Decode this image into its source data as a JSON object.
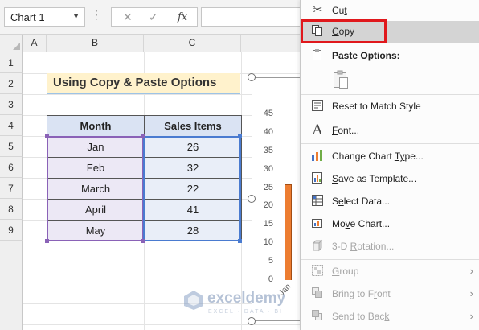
{
  "formula_bar": {
    "name_box": "Chart 1",
    "cancel_icon": "✕",
    "enter_icon": "✓",
    "fx_label": "fx"
  },
  "columns": [
    "A",
    "B",
    "C"
  ],
  "rows": [
    "1",
    "2",
    "3",
    "4",
    "5",
    "6",
    "7",
    "8",
    "9"
  ],
  "sheet": {
    "title": "Using Copy & Paste Options",
    "headers": [
      "Month",
      "Sales Items"
    ],
    "data": [
      [
        "Jan",
        "26"
      ],
      [
        "Feb",
        "32"
      ],
      [
        "March",
        "22"
      ],
      [
        "April",
        "41"
      ],
      [
        "May",
        "28"
      ]
    ]
  },
  "chart_data": {
    "type": "bar",
    "categories": [
      "Jan"
    ],
    "values": [
      26
    ],
    "yticks": [
      "45",
      "40",
      "35",
      "30",
      "25",
      "20",
      "15",
      "10",
      "5",
      "0"
    ],
    "ylim": [
      0,
      45
    ],
    "bar_color": "#ed7d31"
  },
  "watermark": {
    "name": "exceldemy",
    "sub": "EXCEL · DATA · BI"
  },
  "context_menu": {
    "items": [
      {
        "icon": "scissors-icon",
        "label_u": "t",
        "label_pre": "Cu",
        "label_post": "",
        "disabled": false
      },
      {
        "icon": "copy-icon",
        "label_u": "C",
        "label_pre": "",
        "label_post": "opy",
        "disabled": false
      },
      {
        "label": "Paste Options:"
      },
      {
        "label": "Reset to Match Style"
      },
      {
        "label_u": "F",
        "label_pre": "",
        "label_post": "ont..."
      },
      {
        "label_u": "Y",
        "label_pre": "Change Chart ",
        "label_post": "pe..."
      },
      {
        "label_u": "S",
        "label_pre": "",
        "label_post": "ave as Template..."
      },
      {
        "label_u": "E",
        "label_pre": "S",
        "label_post": "lect Data..."
      },
      {
        "label_u": "v",
        "label_pre": "Mo",
        "label_post": "e Chart..."
      },
      {
        "label": "3-D Rotation..."
      },
      {
        "label": "Group"
      },
      {
        "label": "Bring to Front"
      },
      {
        "label": "Send to Back"
      }
    ],
    "labels": {
      "cut_pre": "Cu",
      "cut_u": "t",
      "copy_u": "C",
      "copy_post": "opy",
      "paste_options": "Paste Options:",
      "reset": "Reset to Match Style",
      "font_u": "F",
      "font_post": "ont...",
      "change_pre": "Change Chart ",
      "change_u": "Ty",
      "change_post": "pe...",
      "save_u": "S",
      "save_post": "ave as Template...",
      "select_pre": "S",
      "select_u": "e",
      "select_post": "lect Data...",
      "move_pre": "Mo",
      "move_u": "v",
      "move_post": "e Chart...",
      "rotation_pre": "3-D ",
      "rotation_u": "R",
      "rotation_post": "otation...",
      "group_u": "G",
      "group_post": "roup",
      "bring_pre": "Bring to F",
      "bring_u": "r",
      "bring_post": "ont",
      "send_pre": "Send to Bac",
      "send_u": "k",
      "send_post": ""
    }
  }
}
